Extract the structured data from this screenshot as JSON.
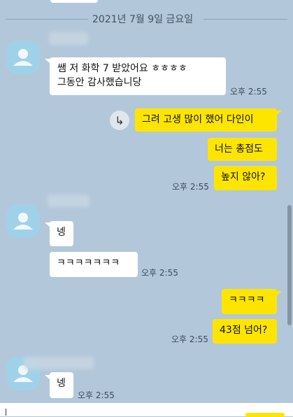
{
  "date_divider": "2021년 7월 9일 금요일",
  "messages": [
    {
      "line1": "쌤 저 화학 7 받았어요 ㅎㅎㅎㅎ",
      "line2": "그동안 감사했습니당",
      "time": "오후 2:55"
    },
    {
      "text": "그려 고생 많이 했어 다인이"
    },
    {
      "text": "너는 총점도"
    },
    {
      "text": "높지 않아?",
      "time": "오후 2:55"
    },
    {
      "text": "넹"
    },
    {
      "text": "ㅋㅋㅋㅋㅋㅋㅋ",
      "time": "오후 2:55"
    },
    {
      "text": "ㅋㅋㅋㅋ"
    },
    {
      "text": "43점 넘어?",
      "time": "오후 2:55"
    },
    {
      "text": "넹",
      "time": "오후 2:55"
    }
  ],
  "reply_icon": "↳",
  "colors": {
    "background": "#b2c7da",
    "incoming": "#ffffff",
    "outgoing": "#fee500"
  }
}
